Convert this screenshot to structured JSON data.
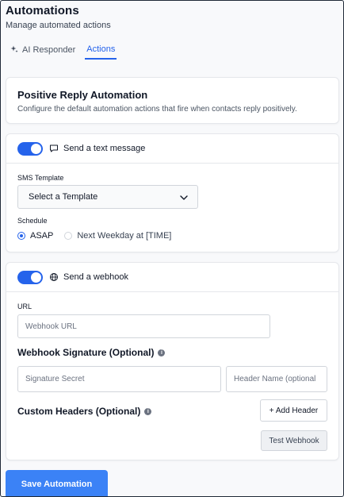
{
  "header": {
    "title": "Automations",
    "subtitle": "Manage automated actions"
  },
  "tabs": [
    {
      "label": "AI Responder",
      "icon": "sparkles-icon",
      "active": false
    },
    {
      "label": "Actions",
      "active": true
    }
  ],
  "positive_reply": {
    "title": "Positive Reply Automation",
    "description": "Configure the default automation actions that fire when contacts reply positively."
  },
  "sms": {
    "toggle_on": true,
    "label": "Send a text message",
    "icon": "message-icon",
    "template_label": "SMS Template",
    "template_value": "Select a Template",
    "schedule_label": "Schedule",
    "schedule_options": [
      {
        "label": "ASAP",
        "selected": true
      },
      {
        "label": "Next Weekday at [TIME]",
        "selected": false
      }
    ]
  },
  "webhook": {
    "toggle_on": true,
    "label": "Send a webhook",
    "icon": "globe-icon",
    "url_label": "URL",
    "url_placeholder": "Webhook URL",
    "signature_title": "Webhook Signature (Optional)",
    "signature_placeholder": "Signature Secret",
    "header_name_placeholder": "Header Name (optional",
    "custom_headers_title": "Custom Headers (Optional)",
    "add_header_label": "+ Add Header",
    "test_label": "Test Webhook"
  },
  "footer": {
    "save_label": "Save Automation"
  },
  "colors": {
    "accent": "#2563eb",
    "save_button": "#3b82f6"
  }
}
